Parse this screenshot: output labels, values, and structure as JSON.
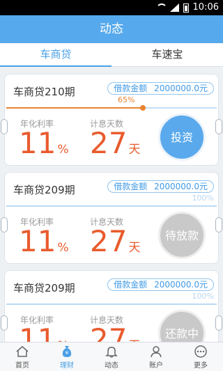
{
  "status": {
    "time": "10:06"
  },
  "header": {
    "title": "动态"
  },
  "tabs": [
    {
      "label": "车商贷",
      "active": true
    },
    {
      "label": "车速宝",
      "active": false
    }
  ],
  "cards": [
    {
      "title": "车商贷210期",
      "amount_label": "借款金额",
      "amount": "2000000.0元",
      "progress_text": "65%",
      "progress_value": 0.65,
      "rate_label": "年化利率",
      "rate_value": "11",
      "rate_unit": "%",
      "days_label": "计息天数",
      "days_value": "27",
      "days_unit": "天",
      "button": "投资",
      "accent": "#e8832f"
    },
    {
      "title": "车商贷209期",
      "amount_label": "借款金额",
      "amount": "2000000.0元",
      "progress_text": "100%",
      "progress_value": 1.0,
      "rate_label": "年化利率",
      "rate_value": "11",
      "rate_unit": "%",
      "days_label": "计息天数",
      "days_value": "27",
      "days_unit": "天",
      "button": "待放款",
      "accent": "#bcdaf3"
    },
    {
      "title": "车商贷209期",
      "amount_label": "借款金额",
      "amount": "2000000.0元",
      "progress_text": "100%",
      "progress_value": 1.0,
      "rate_label": "年化利率",
      "rate_value": "11",
      "rate_unit": "%",
      "days_label": "计息天数",
      "days_value": "27",
      "days_unit": "天",
      "button": "还款中",
      "accent": "#bcdaf3"
    }
  ],
  "bottom_nav": [
    {
      "label": "首页",
      "icon": "home-icon"
    },
    {
      "label": "理财",
      "icon": "money-bag-icon",
      "active": true
    },
    {
      "label": "动态",
      "icon": "bell-icon"
    },
    {
      "label": "账户",
      "icon": "user-icon"
    },
    {
      "label": "更多",
      "icon": "more-icon"
    }
  ],
  "colors": {
    "primary": "#56a9ec",
    "accent": "#e95b2d"
  }
}
